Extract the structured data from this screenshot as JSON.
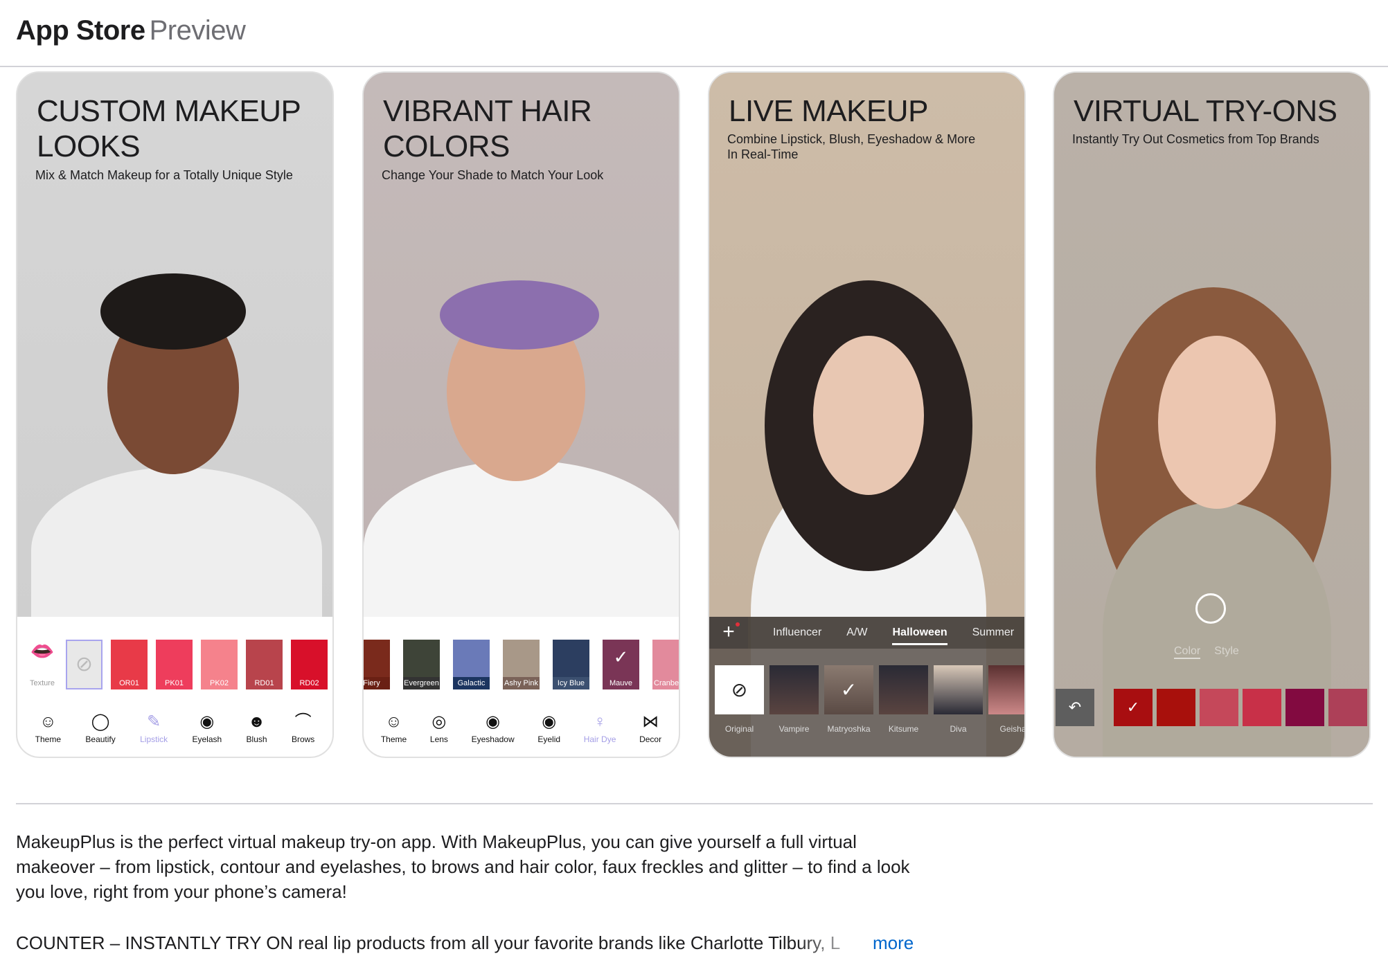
{
  "header": {
    "brand": "App Store",
    "preview": "Preview"
  },
  "cards": [
    {
      "title": "CUSTOM MAKEUP LOOKS",
      "subtitle": "Mix & Match Makeup for a Totally Unique Style",
      "texture_label": "Texture",
      "swatches": [
        {
          "label": "OR01",
          "color": "#e83a48"
        },
        {
          "label": "PK01",
          "color": "#ee3d5c"
        },
        {
          "label": "PK02",
          "color": "#f5828c"
        },
        {
          "label": "RD01",
          "color": "#b8444c"
        },
        {
          "label": "RD02",
          "color": "#d8102a"
        }
      ],
      "tools": [
        "Theme",
        "Beautify",
        "Lipstick",
        "Eyelash",
        "Blush",
        "Brows"
      ],
      "active_tool": "Lipstick"
    },
    {
      "title": "VIBRANT HAIR COLORS",
      "subtitle": "Change Your Shade to Match Your Look",
      "swatches": [
        {
          "label": "Fiery",
          "color": "#7a2a1c"
        },
        {
          "label": "Evergreen",
          "color": "#3e4438"
        },
        {
          "label": "Galactic",
          "color": "#1c3560"
        },
        {
          "label": "Ashy Pink",
          "color": "#7a6258"
        },
        {
          "label": "Icy Blue",
          "color": "#3c5070"
        },
        {
          "label": "Mauve",
          "color": "#7a3556"
        },
        {
          "label": "Cranberry",
          "color": "#e28a9c"
        }
      ],
      "tools": [
        "Theme",
        "Lens",
        "Eyeshadow",
        "Eyelid",
        "Hair Dye",
        "Decor"
      ],
      "active_tool": "Hair Dye"
    },
    {
      "title": "LIVE MAKEUP",
      "subtitle": "Combine Lipstick, Blush, Eyeshadow & More In Real-Time",
      "tabs": [
        "Influencer",
        "A/W",
        "Halloween",
        "Summer"
      ],
      "active_tab": "Halloween",
      "looks": [
        "Original",
        "Vampire",
        "Matryoshka",
        "Kitsume",
        "Diva",
        "Geisha"
      ]
    },
    {
      "title": "VIRTUAL TRY-ONS",
      "subtitle": "Instantly Try Out Cosmetics from Top Brands",
      "mode_tabs": [
        "Color",
        "Style"
      ],
      "lip_colors": [
        "#a80e10",
        "#a8100c",
        "#c5485a",
        "#c83048",
        "#820a40",
        "#ad4058",
        "#c23050"
      ]
    }
  ],
  "description": {
    "paragraph": "MakeupPlus is the perfect virtual makeup try-on app. With MakeupPlus, you can give yourself a full virtual makeover – from lipstick, contour and eyelashes, to brows and hair color, faux freckles and glitter – to find a look you love, right from your phone’s camera!",
    "second_line": "COUNTER – INSTANTLY TRY ON real lip products from all your favorite brands like Charlotte Tilbury, L",
    "more_label": "more"
  }
}
